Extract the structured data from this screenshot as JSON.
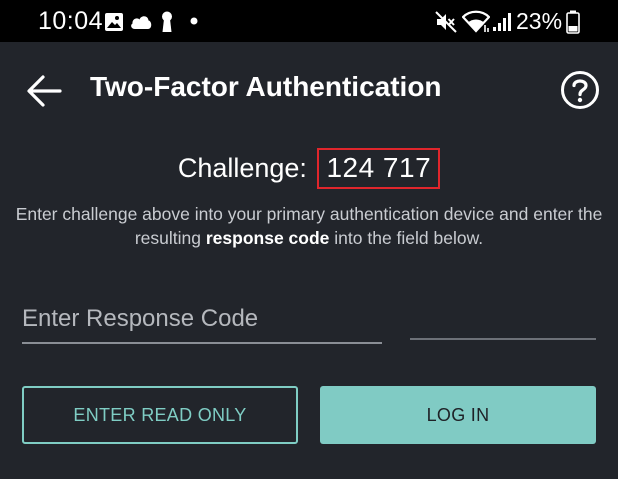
{
  "status_bar": {
    "time": "10:04",
    "battery": "23%",
    "icons": [
      "image-icon",
      "cloud-icon",
      "keyhole-icon",
      "dot-icon",
      "mute-icon",
      "wifi-icon",
      "signal-icon",
      "battery-icon"
    ]
  },
  "header": {
    "title": "Two-Factor Authentication",
    "back_icon": "arrow-left-icon",
    "help_icon": "help-circle-icon"
  },
  "challenge": {
    "label": "Challenge:",
    "code": "124 717",
    "highlight_color": "#e0262c"
  },
  "instructions": {
    "part1": "Enter challenge above into your primary authentication device and enter the resulting ",
    "bold": "response code",
    "part2": " into the field below."
  },
  "form": {
    "response_placeholder": "Enter Response Code",
    "response_value": ""
  },
  "buttons": {
    "read_only": "ENTER READ ONLY",
    "login": "LOG IN"
  },
  "colors": {
    "background": "#22252b",
    "accent": "#80cbc4"
  }
}
